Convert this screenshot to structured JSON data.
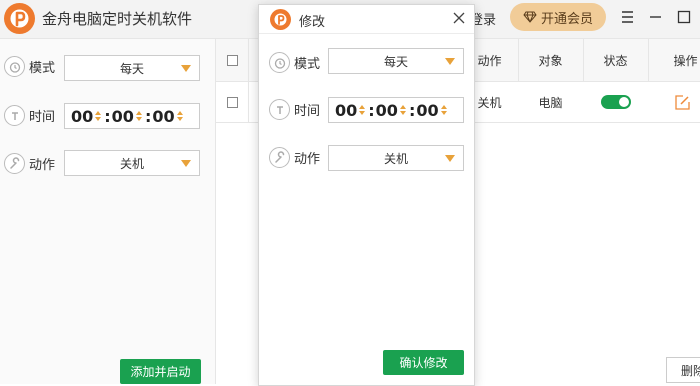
{
  "app": {
    "title": "金舟电脑定时关机软件",
    "login": "登录",
    "vip": "开通会员"
  },
  "left_form": {
    "mode_label": "模式",
    "mode_value": "每天",
    "time_label": "时间",
    "hh": "00",
    "mm": "00",
    "ss": "00",
    "action_label": "动作",
    "action_value": "关机",
    "add_button": "添加并启动"
  },
  "table": {
    "headers": {
      "action": "动作",
      "target": "对象",
      "status": "状态",
      "operate": "操作"
    },
    "rows": [
      {
        "action": "关机",
        "target": "电脑",
        "enabled": true
      }
    ],
    "delete_button": "删除"
  },
  "modal": {
    "title": "修改",
    "mode_label": "模式",
    "mode_value": "每天",
    "time_label": "时间",
    "hh": "00",
    "mm": "00",
    "ss": "00",
    "action_label": "动作",
    "action_value": "关机",
    "confirm_button": "确认修改"
  },
  "colors": {
    "accent_orange": "#ee7a2e",
    "caret": "#e8a23a",
    "green": "#1aa150",
    "vip_gold": "#f1cc98"
  },
  "icons": [
    "app-logo-icon",
    "diamond-icon",
    "menu-icon",
    "minimize-icon",
    "close-icon",
    "alarm-icon",
    "clock-icon",
    "wrench-icon",
    "edit-icon"
  ]
}
